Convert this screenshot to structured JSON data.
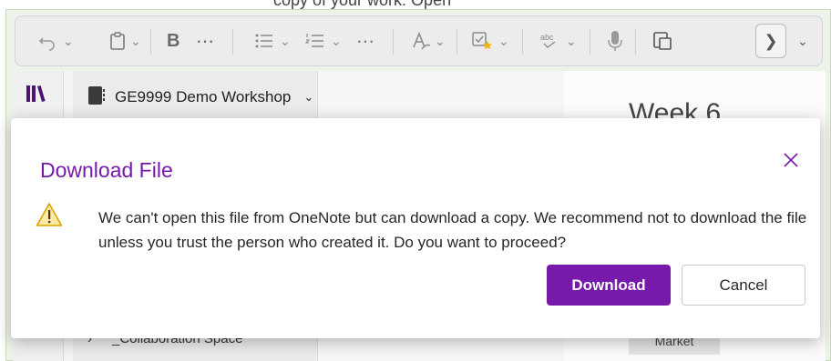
{
  "background": {
    "top_caption": "copy of your work. Open",
    "notebook": {
      "name": "GE9999 Demo Workshop"
    },
    "page_title": "Week 6",
    "section_name": "_Collaboration Space",
    "tag_label": "Market"
  },
  "toolbar": {
    "icons": [
      "undo-icon",
      "paste-icon",
      "bold-icon",
      "more-icon",
      "bullets-icon",
      "numbering-icon",
      "more-icon",
      "styles-icon",
      "tag-icon",
      "spelling-icon",
      "dictate-icon",
      "sticky-icon",
      "next-icon",
      "expand-icon"
    ]
  },
  "dialog": {
    "title": "Download File",
    "message": "We can't open this file from OneNote but can download a copy. We recommend not to download the file unless you trust the person who created it. Do you want to proceed?",
    "primary_button": "Download",
    "secondary_button": "Cancel"
  },
  "colors": {
    "accent": "#7719aa",
    "warning": "#f4b400"
  }
}
